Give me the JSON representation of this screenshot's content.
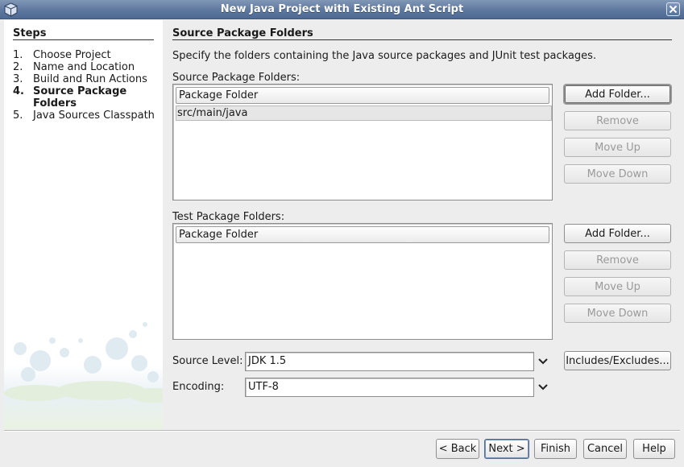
{
  "window": {
    "title": "New Java Project with Existing Ant Script"
  },
  "steps": {
    "title": "Steps",
    "items": [
      {
        "num": "1.",
        "label": "Choose Project"
      },
      {
        "num": "2.",
        "label": "Name and Location"
      },
      {
        "num": "3.",
        "label": "Build and Run Actions"
      },
      {
        "num": "4.",
        "label": "Source Package Folders"
      },
      {
        "num": "5.",
        "label": "Java Sources Classpath"
      }
    ],
    "active_index": 3
  },
  "main": {
    "title": "Source Package Folders",
    "description": "Specify the folders containing the Java source packages and JUnit test packages.",
    "source_folders": {
      "label": "Source Package Folders:",
      "column_header": "Package Folder",
      "rows": [
        "src/main/java"
      ],
      "buttons": {
        "add": "Add Folder...",
        "remove": "Remove",
        "move_up": "Move Up",
        "move_down": "Move Down"
      }
    },
    "test_folders": {
      "label": "Test Package Folders:",
      "column_header": "Package Folder",
      "rows": [],
      "buttons": {
        "add": "Add Folder...",
        "remove": "Remove",
        "move_up": "Move Up",
        "move_down": "Move Down"
      }
    },
    "source_level": {
      "label": "Source Level:",
      "value": "JDK 1.5"
    },
    "encoding": {
      "label": "Encoding:",
      "value": "UTF-8"
    },
    "includes_excludes_label": "Includes/Excludes..."
  },
  "footer": {
    "back": "< Back",
    "next": "Next >",
    "finish": "Finish",
    "cancel": "Cancel",
    "help": "Help"
  },
  "colors": {
    "titlebar": "#5e789e",
    "panel_bg": "#ededed",
    "steps_bg": "#ffffff"
  }
}
